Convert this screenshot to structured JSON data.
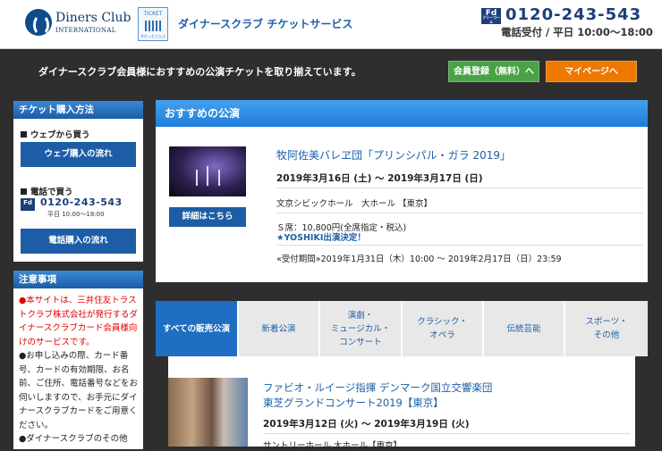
{
  "header": {
    "brand_line1": "Diners Club",
    "brand_line2": "INTERNATIONAL",
    "ticket_logo_top": "TICKET",
    "ticket_logo_bottom": "ちけっとくらぶ",
    "site_name": "ダイナースクラブ チケットサービス",
    "phone_badge": "Fd",
    "phone_badge_sub": "フリーコール",
    "phone_number": "0120-243-543",
    "hours": "電話受付 / 平日 10:00〜18:00"
  },
  "topbar": {
    "intro": "ダイナースクラブ会員様におすすめの公演チケットを取り揃えています。",
    "register_button": "会員登録（無料）へ",
    "mypage_button": "マイページへ"
  },
  "sidebar": {
    "howto_title": "チケット購入方法",
    "web_label": "ウェブから買う",
    "web_button": "ウェブ購入の流れ",
    "phone_label": "電話で買う",
    "phone_number": "0120-243-543",
    "phone_hours": "平日 10:00〜18:00",
    "phone_button": "電話購入の流れ",
    "notice_title": "注意事項",
    "notice_red": "●本サイトは、三井住友トラストクラブ株式会社が発行するダイナースクラブカード会員様向けのサービスです。",
    "notice_2": "●お申し込みの際、カード番号、カードの有効期限、お名前、ご住所、電話番号などをお伺いしますので、お手元にダイナースクラブカードをご用意ください。",
    "notice_3": "●ダイナースクラブのその他"
  },
  "recommended": {
    "heading": "おすすめの公演",
    "title": "牧阿佐美バレヱ団「プリンシパル・ガラ 2019」",
    "date": "2019年3月16日 (土) 〜 2019年3月17日 (日)",
    "venue": "文京シビックホール　大ホール 【東京】",
    "price": "Ｓ席：10,800円(全席指定・税込)",
    "note": "★YOSHIKI出演決定！",
    "period": "«受付期間»2019年1月31日（木）10:00 〜 2019年2月17日（日）23:59",
    "details_button": "詳細はこちら"
  },
  "tabs": [
    {
      "label": "すべての販売公演"
    },
    {
      "label": "新着公演"
    },
    {
      "label": "演劇・\nミュージカル・\nコンサート"
    },
    {
      "label": "クラシック・\nオペラ"
    },
    {
      "label": "伝統芸能"
    },
    {
      "label": "スポーツ・\nその他"
    }
  ],
  "card": {
    "title1": "ファビオ・ルイージ指揮 デンマーク国立交響楽団",
    "title2": "東芝グランドコンサート2019【東京】",
    "date": "2019年3月12日 (火) 〜 2019年3月19日 (火)",
    "venue": "サントリーホール 大ホール【東京】"
  },
  "colors": {
    "brand_blue": "#1c5da6",
    "register_green": "#4aa247",
    "mypage_orange": "#ee7800",
    "notice_red": "#e00000",
    "background": "#2e2e2e"
  }
}
